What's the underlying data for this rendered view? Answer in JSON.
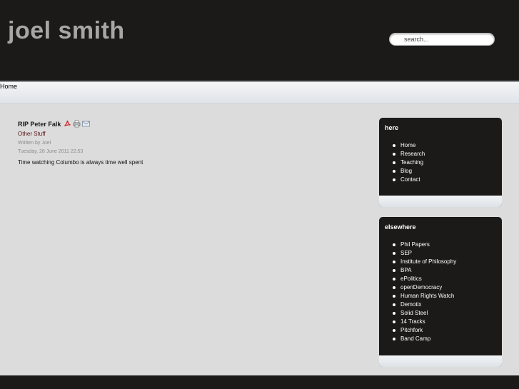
{
  "site": {
    "title": "joel smith"
  },
  "search": {
    "placeholder": "search..."
  },
  "nav": {
    "home": "Home"
  },
  "article": {
    "title": "RIP Peter Falk",
    "icons": [
      "pdf-icon",
      "print-icon",
      "email-icon"
    ],
    "category": "Other Stuff",
    "written_by": "Written by Joel",
    "date": "Tuesday, 28 June 2011 22:53",
    "body": "Time watching Columbo is always time well spent"
  },
  "sidebar": {
    "here": {
      "title": "here",
      "items": [
        "Home",
        "Research",
        "Teaching",
        "Blog",
        "Contact"
      ]
    },
    "elsewhere": {
      "title": "elsewhere",
      "items": [
        "Phil Papers",
        "SEP",
        "Institute of Philosophy",
        "BPA",
        "ePolitics",
        "openDemocracy",
        "Human Rights Watch",
        "Demotix",
        "Solid Steel",
        "14 Tracks",
        "Pitchfork",
        "Band Camp"
      ]
    }
  },
  "colors": {
    "header_bg": "#1b1a19",
    "page_bg": "#dcdcdc",
    "title_gray": "#a6a6a6",
    "category_link": "#5a1414"
  }
}
